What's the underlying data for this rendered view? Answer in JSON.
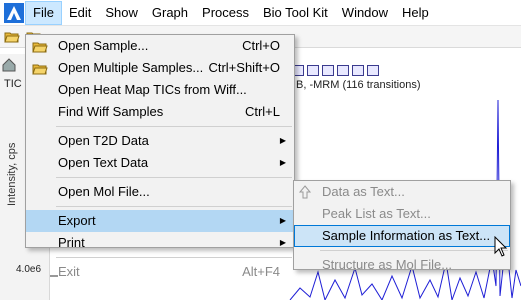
{
  "menubar": {
    "items": [
      "File",
      "Edit",
      "Show",
      "Graph",
      "Process",
      "Bio Tool Kit",
      "Window",
      "Help"
    ]
  },
  "chart": {
    "side_label": "TIC",
    "title": "B, -MRM (116 transitions)",
    "ylabel": "Intensity, cps",
    "y_tick": "4.0e6"
  },
  "file_menu": {
    "items": [
      {
        "label": "Open Sample...",
        "shortcut": "Ctrl+O"
      },
      {
        "label": "Open Multiple Samples...",
        "shortcut": "Ctrl+Shift+O"
      },
      {
        "label": "Open Heat Map TICs from Wiff...",
        "shortcut": ""
      },
      {
        "label": "Find Wiff Samples",
        "shortcut": "Ctrl+L"
      },
      {
        "label": "Open T2D Data",
        "shortcut": ""
      },
      {
        "label": "Open Text Data",
        "shortcut": ""
      },
      {
        "label": "Open Mol File...",
        "shortcut": ""
      },
      {
        "label": "Export",
        "shortcut": ""
      },
      {
        "label": "Print",
        "shortcut": ""
      },
      {
        "label": "Exit",
        "shortcut": "Alt+F4"
      }
    ]
  },
  "export_menu": {
    "items": [
      {
        "label": "Data as Text..."
      },
      {
        "label": "Peak List as Text..."
      },
      {
        "label": "Sample Information as Text..."
      },
      {
        "label": "Structure as Mol File..."
      }
    ]
  },
  "colors": {
    "trace": "#1f1fd6",
    "menu_highlight": "#b3d7f3",
    "active_border": "#0078d7"
  }
}
